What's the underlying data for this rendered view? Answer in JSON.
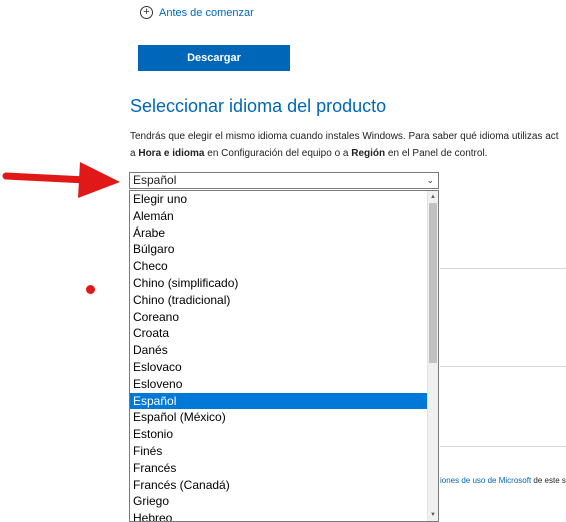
{
  "before_start": {
    "label": "Antes de comenzar"
  },
  "download_button": {
    "label": "Descargar"
  },
  "section": {
    "title": "Seleccionar idioma del producto",
    "line1": "Tendrás que elegir el mismo idioma cuando instales Windows. Para saber qué idioma utilizas act",
    "line2_pre": "a ",
    "line2_bold1": "Hora e idioma",
    "line2_mid": " en Configuración del equipo o a ",
    "line2_bold2": "Región",
    "line2_post": " en el Panel de control."
  },
  "language_select": {
    "selected_value": "Español",
    "options": [
      "Elegir uno",
      "Alemán",
      "Árabe",
      "Búlgaro",
      "Checo",
      "Chino (simplificado)",
      "Chino (tradicional)",
      "Coreano",
      "Croata",
      "Danés",
      "Eslovaco",
      "Esloveno",
      "Español",
      "Español (México)",
      "Estonio",
      "Finés",
      "Francés",
      "Francés (Canadá)",
      "Griego",
      "Hebreo"
    ],
    "highlighted_option": "Español"
  },
  "terms": {
    "link": "iones de uso de Microsoft",
    "after": " de este s"
  },
  "colors": {
    "accent": "#0067b8",
    "selected_option": "#0078d7",
    "annotation_red": "#e01818"
  }
}
